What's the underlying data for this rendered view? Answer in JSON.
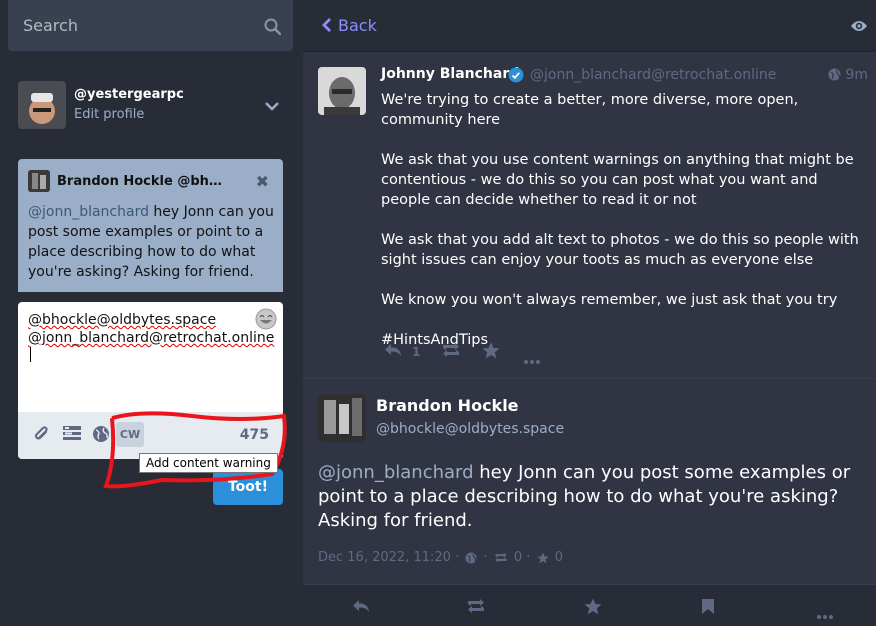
{
  "search": {
    "placeholder": "Search",
    "icon": "search-icon"
  },
  "account": {
    "handle": "@yestergearpc",
    "edit_label": "Edit profile"
  },
  "reply_card": {
    "author": "Brandon Hockle @bhockle…",
    "mention": "@jonn_blanchard",
    "text": " hey Jonn can you post some examples or point to a place describing how to do what you're asking? Asking for friend."
  },
  "compose": {
    "line1": "@bhockle@oldbytes.space",
    "line2": "@jonn_blanchard@retrochat.online",
    "cw_label": "CW",
    "counter": "475",
    "tooltip": "Add content warning",
    "submit_label": "Toot!"
  },
  "column": {
    "back_label": "Back"
  },
  "post1": {
    "name": "Johnny Blanchard",
    "acct": "@jonn_blanchard@retrochat.online",
    "time": "9m",
    "paragraphs": [
      "We're trying to create a better, more diverse, more open, community here",
      "We ask that you use content warnings on anything that might be contentious - we do this so you can post what you want and people can decide whether to read it or not",
      "We ask that you add alt text to photos - we do this so people with sight issues can enjoy your toots as much as everyone else",
      "We know you won't always remember, we just ask that you try",
      "#HintsAndTips"
    ],
    "reply_count": "1"
  },
  "detail": {
    "name": "Brandon Hockle",
    "acct": "@bhockle@oldbytes.space",
    "mention": "@jonn_blanchard",
    "text": " hey Jonn can you post some examples or point to a place describing how to do what you're asking? Asking for friend.",
    "date": "Dec 16, 2022, 11:20",
    "boosts": "0",
    "favs": "0"
  },
  "colors": {
    "accent": "#2b90d9",
    "link": "#8c8dff",
    "muted": "#606984",
    "panel": "#313543"
  }
}
